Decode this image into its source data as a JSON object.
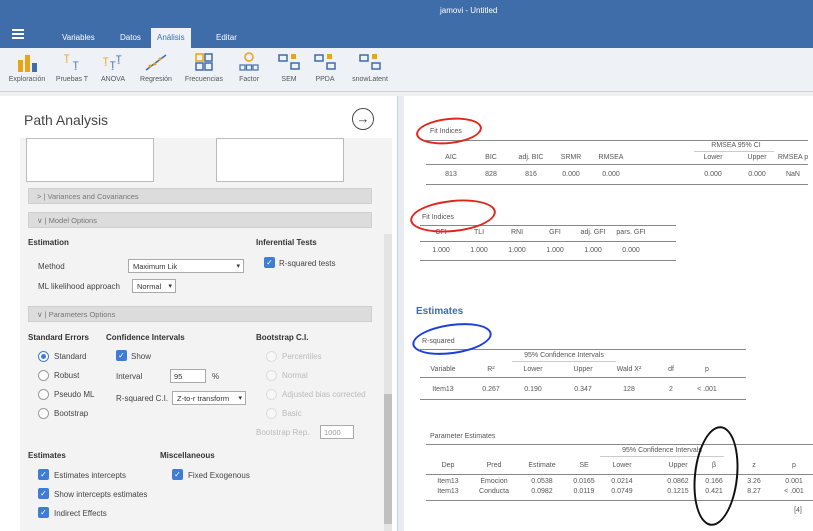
{
  "window": {
    "title": "jamovi - Untitled"
  },
  "menu": {
    "tabs": [
      "Variables",
      "Datos",
      "Análisis",
      "Editar"
    ],
    "active": "Análisis"
  },
  "ribbon": {
    "items": [
      "Exploración",
      "Pruebas T",
      "ANOVA",
      "Regresión",
      "Frecuencias",
      "Factor",
      "SEM",
      "PPDA",
      "snowLatent"
    ]
  },
  "panel": {
    "title": "Path Analysis",
    "sections": {
      "variances": "Variances and Covariances",
      "model": "Model Options",
      "params": "Parameters Options"
    },
    "estimation": {
      "heading": "Estimation",
      "method_label": "Method",
      "method_value": "Maximum Lik",
      "ml_label": "ML likelihood approach",
      "ml_value": "Normal"
    },
    "inferential": {
      "heading": "Inferential Tests",
      "rsq_tests": "R-squared tests"
    },
    "std_errors": {
      "heading": "Standard Errors",
      "options": [
        "Standard",
        "Robust",
        "Pseudo ML",
        "Bootstrap"
      ]
    },
    "ci": {
      "heading": "Confidence Intervals",
      "show": "Show",
      "interval_label": "Interval",
      "interval_value": "95",
      "pct": "%",
      "rsq_ci_label": "R-squared C.I.",
      "rsq_ci_value": "Z-to-r transform"
    },
    "boot": {
      "heading": "Bootstrap C.I.",
      "options": [
        "Percentiles",
        "Normal",
        "Adjusted bias corrected",
        "Basic"
      ],
      "reps_label": "Bootstrap Rep.",
      "reps_value": "1000"
    },
    "estimates": {
      "heading": "Estimates",
      "items": [
        "Estimates intercepts",
        "Show intercepts estimates",
        "Indirect Effects"
      ]
    },
    "misc": {
      "heading": "Miscellaneous",
      "fixed_exo": "Fixed Exogenous"
    }
  },
  "results": {
    "fit1": {
      "caption": "Fit Indices",
      "span_header": "RMSEA 95% CI",
      "headers": [
        "AIC",
        "BIC",
        "adj. BIC",
        "SRMR",
        "RMSEA",
        "Lower",
        "Upper",
        "RMSEA p"
      ],
      "row": [
        "813",
        "828",
        "816",
        "0.000",
        "0.000",
        "0.000",
        "0.000",
        "NaN"
      ]
    },
    "fit2": {
      "caption": "Fit Indices",
      "headers": [
        "CFI",
        "TLI",
        "RNI",
        "GFI",
        "adj. GFI",
        "pars. GFI"
      ],
      "row": [
        "1.000",
        "1.000",
        "1.000",
        "1.000",
        "1.000",
        "0.000"
      ]
    },
    "estimates_heading": "Estimates",
    "rsq": {
      "caption": "R-squared",
      "span_header": "95% Confidence Intervals",
      "headers": [
        "Variable",
        "R²",
        "Lower",
        "Upper",
        "Wald X²",
        "df",
        "p"
      ],
      "row": [
        "Item13",
        "0.267",
        "0.190",
        "0.347",
        "128",
        "2",
        "< .001"
      ]
    },
    "params": {
      "caption": "Parameter Estimates",
      "span_header": "95% Confidence Intervals",
      "headers": [
        "Dep",
        "Pred",
        "Estimate",
        "SE",
        "Lower",
        "Upper",
        "β",
        "z",
        "p"
      ],
      "rows": [
        [
          "Item13",
          "Emocion",
          "0.0538",
          "0.0165",
          "0.0214",
          "0.0862",
          "0.166",
          "3.26",
          "0.001"
        ],
        [
          "Item13",
          "Conducta",
          "0.0982",
          "0.0119",
          "0.0749",
          "0.1215",
          "0.421",
          "8.27",
          "< .001"
        ]
      ],
      "footnote": "[4]"
    }
  },
  "colors": {
    "accent": "#3e6da9",
    "checkbox": "#3e7cd6",
    "annotation_red": "#e0261c",
    "annotation_blue": "#1d3fd9",
    "annotation_black": "#111111"
  }
}
